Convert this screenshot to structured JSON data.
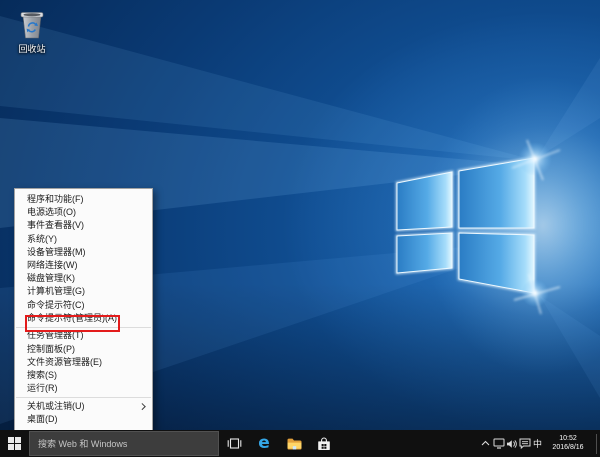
{
  "desktop": {
    "recycle_bin": {
      "label": "回收站"
    }
  },
  "context_menu": {
    "items": [
      {
        "label": "程序和功能(F)"
      },
      {
        "label": "电源选项(O)"
      },
      {
        "label": "事件查看器(V)"
      },
      {
        "label": "系统(Y)"
      },
      {
        "label": "设备管理器(M)"
      },
      {
        "label": "网络连接(W)"
      },
      {
        "label": "磁盘管理(K)"
      },
      {
        "label": "计算机管理(G)"
      },
      {
        "label": "命令提示符(C)"
      },
      {
        "label": "命令提示符(管理员)(A)",
        "annotated": true
      },
      {
        "label": "任务管理器(T)"
      },
      {
        "label": "控制面板(P)"
      },
      {
        "label": "文件资源管理器(E)"
      },
      {
        "label": "搜索(S)"
      },
      {
        "label": "运行(R)"
      },
      {
        "label": "关机或注销(U)",
        "has_submenu": true
      },
      {
        "label": "桌面(D)"
      }
    ]
  },
  "taskbar": {
    "search": {
      "placeholder": "搜索 Web 和 Windows"
    },
    "icons": {
      "edge_glyph": "e"
    },
    "tray": {
      "ime_label": "中",
      "time": "10:52",
      "date": "2016/8/16"
    }
  },
  "icon_map": {
    "start": "windows-flag",
    "task_view": "rect-with-side-panels",
    "edge": "letter-e",
    "file_explorer": "yellow-folder",
    "store": "shopping-bag",
    "tray_expand": "chevron-up",
    "network": "monitor",
    "volume": "speaker",
    "action_center": "chat-bubble",
    "recycle_bin": "trash-bin"
  },
  "colors": {
    "annotation_red": "#e31b1b",
    "taskbar_bg": "#101010",
    "menu_bg": "#fbfbfb",
    "search_box_bg": "#3d3d3d",
    "logo_blue": "#55aae6",
    "wallpaper_dark": "#03122a"
  }
}
